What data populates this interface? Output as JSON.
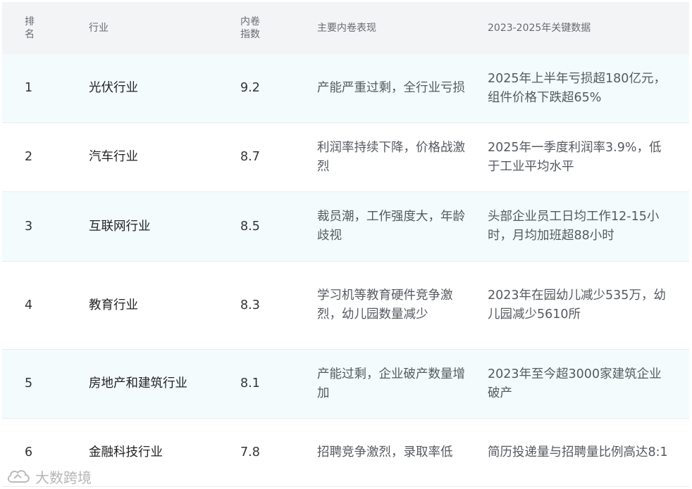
{
  "header": {
    "rank": "排名",
    "industry": "行业",
    "index": "内卷指数",
    "performance": "主要内卷表现",
    "key_data": "2023-2025年关键数据"
  },
  "rows": [
    {
      "rank": "1",
      "industry": "光伏行业",
      "index": "9.2",
      "performance": "产能严重过剩，全行业亏损",
      "key_data": "2025年上半年亏损超180亿元，组件价格下跌超65%"
    },
    {
      "rank": "2",
      "industry": "汽车行业",
      "index": "8.7",
      "performance": "利润率持续下降，价格战激烈",
      "key_data": "2025年一季度利润率3.9%，低于工业平均水平"
    },
    {
      "rank": "3",
      "industry": "互联网行业",
      "index": "8.5",
      "performance": "裁员潮，工作强度大，年龄歧视",
      "key_data": "头部企业员工日均工作12-15小时，月均加班超88小时"
    },
    {
      "rank": "4",
      "industry": "教育行业",
      "index": "8.3",
      "performance": "学习机等教育硬件竞争激烈，幼儿园数量减少",
      "key_data": "2023年在园幼儿减少535万，幼儿园减少5610所"
    },
    {
      "rank": "5",
      "industry": "房地产和建筑行业",
      "index": "8.1",
      "performance": "产能过剩，企业破产数量增加",
      "key_data": "2023年至今超3000家建筑企业破产"
    },
    {
      "rank": "6",
      "industry": "金融科技行业",
      "index": "7.8",
      "performance": "招聘竞争激烈，录取率低",
      "key_data": "简历投递量与招聘量比例高达8:1"
    }
  ],
  "watermark": {
    "text": "大数跨境",
    "icon": "cloud-logo-icon"
  }
}
